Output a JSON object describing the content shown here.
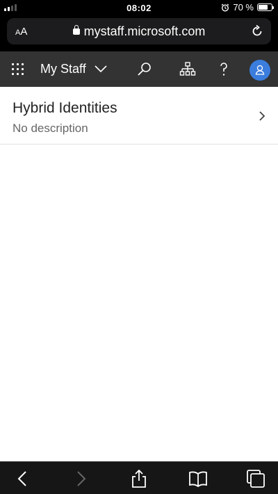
{
  "status_bar": {
    "time": "08:02",
    "battery_text": "70 %",
    "battery_level": 0.7,
    "signal_bars": 2
  },
  "browser": {
    "text_size_label": "AA",
    "domain": "mystaff.microsoft.com"
  },
  "header": {
    "title": "My Staff",
    "accent_color": "#3b7ddd",
    "background_color": "#333333"
  },
  "list": [
    {
      "title": "Hybrid Identities",
      "description": "No description"
    }
  ],
  "icons": {
    "waffle": "app-launcher-icon",
    "dropdown": "chevron-down-icon",
    "search": "search-icon",
    "org": "org-chart-icon",
    "help": "help-icon",
    "avatar": "person-icon",
    "item_chevron": "chevron-right-icon",
    "back": "back-arrow-icon",
    "forward": "forward-arrow-icon",
    "share": "share-icon",
    "bookmarks": "book-icon",
    "tabs": "tabs-icon"
  }
}
